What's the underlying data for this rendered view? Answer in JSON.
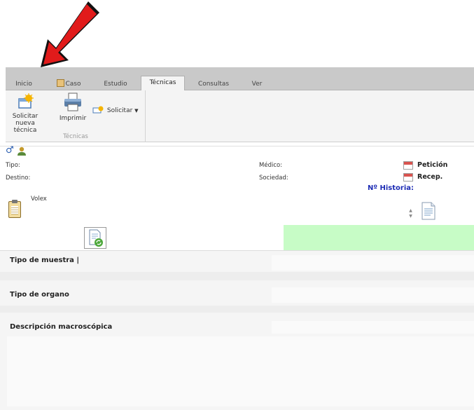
{
  "tabs": [
    {
      "label": "Inicio",
      "active": false
    },
    {
      "label": "Caso",
      "active": false
    },
    {
      "label": "Estudio",
      "active": false
    },
    {
      "label": "Técnicas",
      "active": true
    },
    {
      "label": "Consultas",
      "active": false
    },
    {
      "label": "Ver",
      "active": false
    }
  ],
  "ribbon": {
    "solicitar_nueva_line1": "Solicitar",
    "solicitar_nueva_line2": "nueva técnica",
    "imprimir": "Imprimir",
    "solicitar_dropdown": "Solicitar",
    "group_label": "Técnicas"
  },
  "patient": {
    "tipo_label": "Tipo:",
    "destino_label": "Destino:",
    "medico_label": "Médico:",
    "sociedad_label": "Sociedad:",
    "peticion_label": "Petición",
    "recep_label": "Recep.",
    "historia_label": "Nº Historia:",
    "volex_label": "Volex"
  },
  "form": {
    "tipo_muestra": "Tipo de muestra",
    "tipo_organo": "Tipo de organo",
    "descripcion": "Descripción macroscópica"
  },
  "colors": {
    "accent_green": "#c7fcc6",
    "historia_blue": "#1e2db5",
    "arrow_red": "#e11b1b"
  }
}
